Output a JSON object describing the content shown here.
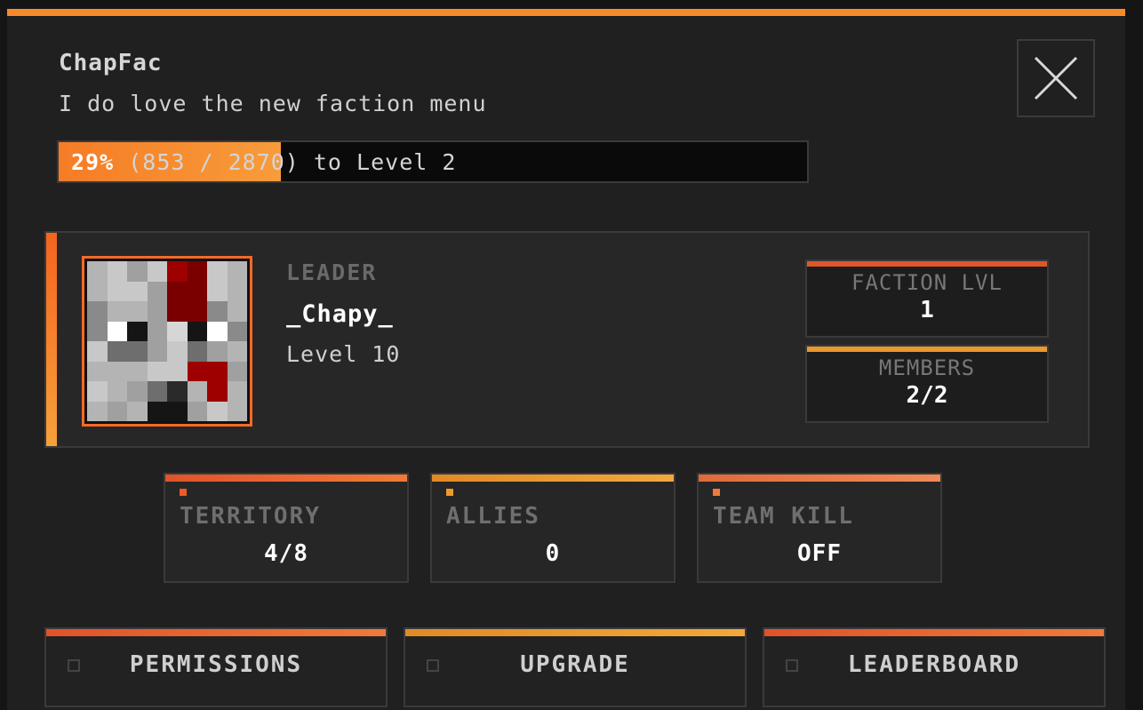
{
  "colors": {
    "accent_orange": "#f68a2a",
    "accent_red_orange": "#f3641f",
    "accent_amber": "#e89a2c",
    "panel_bg": "#202020"
  },
  "header": {
    "title": "ChapFac",
    "motd": "I do love the new faction menu",
    "close_icon": "close-icon"
  },
  "xp": {
    "percent_text": "29%",
    "detail_text": "(853 / 2870) to Level 2",
    "progress": 0.297
  },
  "leader": {
    "caption": "LEADER",
    "name": "_Chapy_",
    "level": "Level 10",
    "avatar_icon": "player-skin-face-icon"
  },
  "faction_stats": {
    "level_label": "FACTION LVL",
    "level_value": "1",
    "members_label": "MEMBERS",
    "members_value": "2/2"
  },
  "cards": [
    {
      "label": "TERRITORY",
      "value": "4/8"
    },
    {
      "label": "ALLIES",
      "value": "0"
    },
    {
      "label": "TEAM KILL",
      "value": "OFF"
    }
  ],
  "buttons": [
    {
      "label": "PERMISSIONS"
    },
    {
      "label": "UPGRADE"
    },
    {
      "label": "LEADERBOARD"
    }
  ]
}
